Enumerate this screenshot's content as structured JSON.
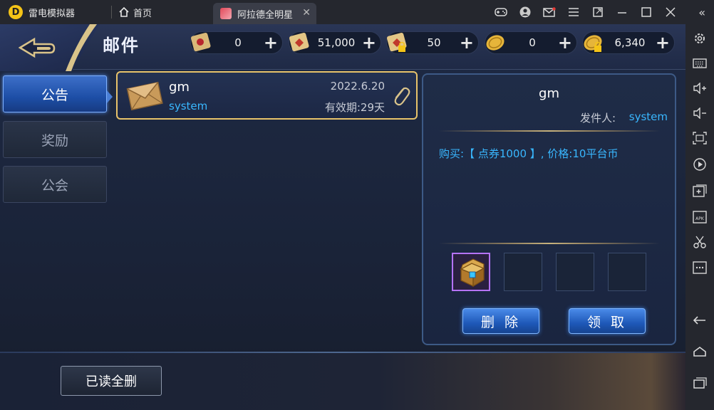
{
  "emulator": {
    "app_name": "雷电模拟器",
    "home_tab_label": "首页",
    "game_tab_label": "阿拉德全明星",
    "icons": [
      "gamepad-icon",
      "user-icon",
      "mail-icon",
      "menu-icon",
      "fullscreen-icon",
      "minimize-icon",
      "maximize-icon",
      "close-icon",
      "collapse-icon"
    ],
    "side_tools": [
      "settings-icon",
      "keyboard-icon",
      "volume-up-icon",
      "volume-down-icon",
      "screenshot-icon",
      "record-icon",
      "add-window-icon",
      "apk-install-icon",
      "cut-icon",
      "more-icon",
      "back-icon",
      "home-icon",
      "recent-apps-icon"
    ]
  },
  "game": {
    "page_title": "邮件",
    "currencies": [
      {
        "name": "scroll-red",
        "value": "0"
      },
      {
        "name": "scroll-gold",
        "value": "51,000"
      },
      {
        "name": "scroll-locked",
        "value": "50"
      },
      {
        "name": "coin",
        "value": "0"
      },
      {
        "name": "coin-locked",
        "value": "6,340"
      }
    ],
    "tabs": [
      {
        "label": "公告",
        "active": true
      },
      {
        "label": "奖励",
        "active": false
      },
      {
        "label": "公会",
        "active": false
      }
    ],
    "mail": {
      "title": "gm",
      "from": "system",
      "date": "2022.6.20",
      "expire": "有效期:29天"
    },
    "detail": {
      "title": "gm",
      "sender_label": "发件人:",
      "sender_value": "system",
      "body": "购买:【 点券1000 】, 价格:10平台币",
      "attachment_slots": 4,
      "delete_label": "删 除",
      "claim_label": "领 取"
    },
    "delete_all_label": "已读全删"
  },
  "colors": {
    "accent_blue": "#39b7ff",
    "gold_border": "#e8c36a",
    "button_blue": "#1e58b8"
  }
}
